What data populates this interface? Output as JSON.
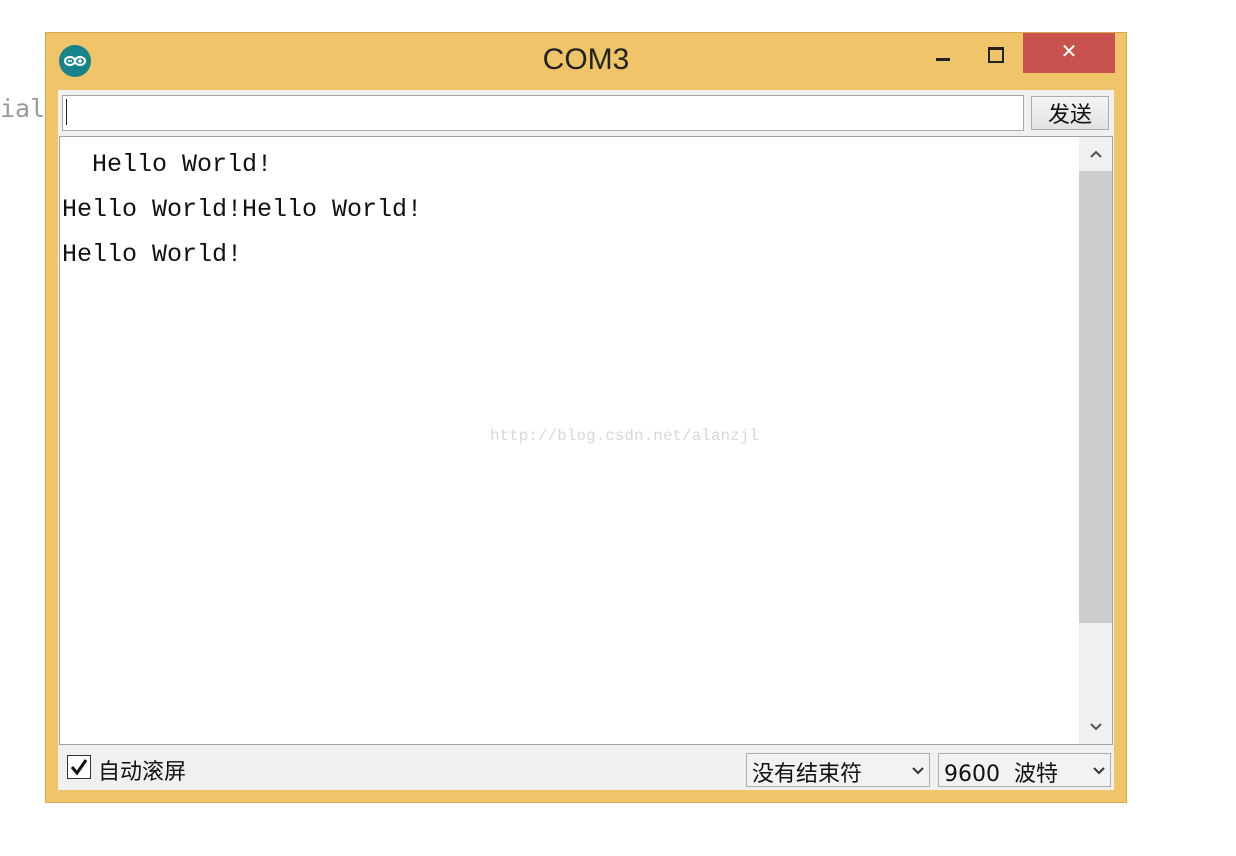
{
  "background": {
    "fragment_text": "ial"
  },
  "window": {
    "title": "COM3",
    "close_glyph": "✕"
  },
  "input_row": {
    "value": "",
    "send_label": "发送"
  },
  "output": {
    "lines": [
      "  Hello World!",
      "Hello World!Hello World!",
      "Hello World!"
    ],
    "watermark": "http://blog.csdn.net/alanzjl"
  },
  "scrollbar": {
    "up_icon": "chevron-up-icon",
    "down_icon": "chevron-down-icon"
  },
  "bottom_bar": {
    "autoscroll_checked": true,
    "autoscroll_label": "自动滚屏",
    "line_ending_selected": "没有结束符",
    "baud_selected": "9600  波特"
  },
  "colors": {
    "frame": "#f0c468",
    "close_button": "#c9514e",
    "app_icon": "#17838a"
  }
}
